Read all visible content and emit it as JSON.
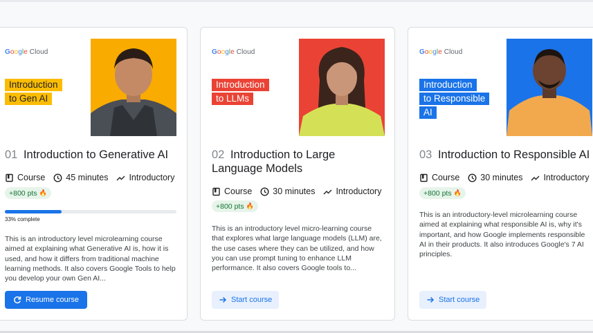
{
  "courses": [
    {
      "brand": "Google Cloud",
      "banner": [
        "Introduction",
        "to Gen AI"
      ],
      "number": "01",
      "title": "Introduction to Generative AI",
      "type": "Course",
      "duration": "45 minutes",
      "level": "Introductory",
      "points": "+800 pts",
      "progress": 0.33,
      "progress_label": "33% complete",
      "description": "This is an introductory level microlearning course aimed at explaining what Generative AI is, how it is used, and how it differs from traditional machine learning methods. It also covers Google Tools to help you develop your own Gen AI...",
      "button": "Resume course"
    },
    {
      "brand": "Google Cloud",
      "banner": [
        "Introduction",
        "to LLMs"
      ],
      "number": "02",
      "title": "Introduction to Large Language Models",
      "type": "Course",
      "duration": "30 minutes",
      "level": "Introductory",
      "points": "+800 pts",
      "description": "This is an introductory level micro-learning course that explores what large language models (LLM) are, the use cases where they can be utilized, and how you can use prompt tuning to enhance LLM performance. It also covers Google tools to...",
      "button": "Start course"
    },
    {
      "brand": "Google Cloud",
      "banner": [
        "Introduction",
        "to Responsible",
        "AI"
      ],
      "number": "03",
      "title": "Introduction to Responsible AI",
      "type": "Course",
      "duration": "30 minutes",
      "level": "Introductory",
      "points": "+800 pts",
      "description": "This is an introductory-level microlearning course aimed at explaining what responsible AI is, why it's important, and how Google implements responsible AI in their products. It also introduces Google's 7 AI principles.",
      "button": "Start course"
    }
  ],
  "colors": {
    "accent": "#1a73e8",
    "banner_yellow": "#fbbc04",
    "banner_red": "#ea4335",
    "banner_blue": "#1a73e8",
    "points_bg": "#e6f4ea"
  },
  "icons": [
    "book-icon",
    "clock-icon",
    "trend-icon",
    "flame-icon",
    "refresh-icon",
    "arrow-right-icon"
  ]
}
